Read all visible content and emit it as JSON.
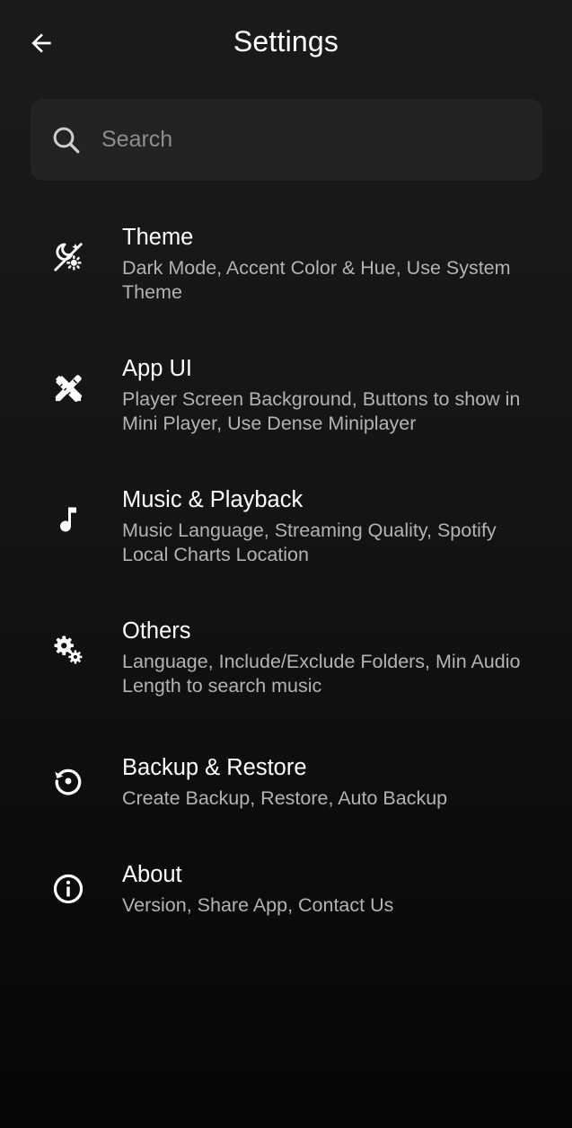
{
  "header": {
    "title": "Settings",
    "back_icon": "arrow-back-icon"
  },
  "search": {
    "placeholder": "Search",
    "value": "",
    "icon": "search-icon"
  },
  "settings_items": [
    {
      "icon": "theme-icon",
      "title": "Theme",
      "subtitle": "Dark Mode, Accent Color & Hue, Use System Theme"
    },
    {
      "icon": "design-tools-icon",
      "title": "App UI",
      "subtitle": "Player Screen Background, Buttons to show in Mini Player, Use Dense Miniplayer"
    },
    {
      "icon": "music-note-icon",
      "title": "Music & Playback",
      "subtitle": "Music Language, Streaming Quality, Spotify Local Charts Location"
    },
    {
      "icon": "gears-icon",
      "title": "Others",
      "subtitle": "Language, Include/Exclude Folders, Min Audio Length to search music"
    },
    {
      "icon": "restore-icon",
      "title": "Backup & Restore",
      "subtitle": "Create Backup, Restore, Auto Backup"
    },
    {
      "icon": "info-icon",
      "title": "About",
      "subtitle": "Version, Share App, Contact Us"
    }
  ],
  "colors": {
    "background": "#141414",
    "search_background": "#232323",
    "title_text": "#ffffff",
    "subtitle_text": "#b3b3b3",
    "placeholder_text": "#8e8e8e"
  }
}
